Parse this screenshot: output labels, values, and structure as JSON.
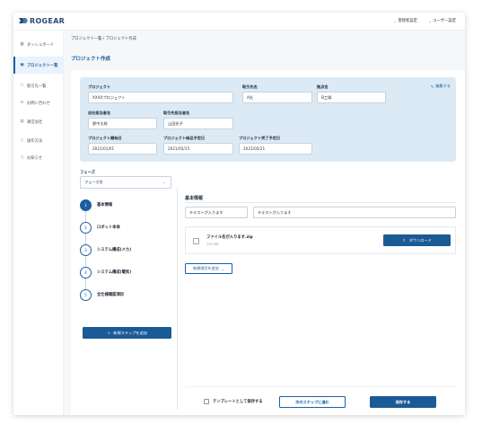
{
  "app": {
    "logo_text": "ROGEAR"
  },
  "topbar": {
    "admin_settings": "管理者設定",
    "user_settings": "ユーザー設定"
  },
  "sidebar": {
    "items": [
      {
        "label": "ダッシュボード",
        "icon": "dashboard-icon"
      },
      {
        "label": "プロジェクト一覧",
        "icon": "project-icon",
        "active": true
      },
      {
        "label": "取引先一覧",
        "icon": "client-icon"
      },
      {
        "label": "お問い合わせ",
        "icon": "mail-icon"
      },
      {
        "label": "運営会社",
        "icon": "building-icon"
      },
      {
        "label": "操作方法",
        "icon": "document-icon"
      },
      {
        "label": "お知らせ",
        "icon": "bell-icon"
      }
    ]
  },
  "main": {
    "breadcrumb": "プロジェクト一覧 / プロジェクト作成",
    "title": "プロジェクト作成"
  },
  "info": {
    "edit_link": "編集する",
    "project_label": "プロジェクト",
    "project_value": "XXXXプロジェクト",
    "client_label": "取引先名",
    "client_value": "A社",
    "site_label": "拠点名",
    "site_value": "B工場",
    "own_manager_label": "自社担当者名",
    "own_manager_value": "野中太郎",
    "client_manager_label": "取引先担当者名",
    "client_manager_value": "山田花子",
    "start_label": "プロジェクト開始日",
    "start_value": "2021/01/01",
    "delivery_label": "プロジェクト納品予定日",
    "delivery_value": "2021/05/15",
    "end_label": "プロジェクト完了予定日",
    "end_value": "2021/05/21"
  },
  "phase": {
    "label": "フェーズ",
    "selected": "フェーズ名"
  },
  "steps": [
    {
      "num": "1",
      "label": "基本情報",
      "active": true
    },
    {
      "num": "2",
      "label": "ロボット本体"
    },
    {
      "num": "3",
      "label": "システム構成(メカ)"
    },
    {
      "num": "4",
      "label": "システム構成(電気)"
    },
    {
      "num": "5",
      "label": "全仕様確認項目"
    }
  ],
  "add_step_label": "新規ステップを追加",
  "basic": {
    "title": "基本情報",
    "input1": "テキストが入ります",
    "input2": "テキストが入ります",
    "file_name": "ファイル名が入ります.zip",
    "file_size": "120 MB",
    "download_label": "ダウンロード",
    "add_item_label": "新規項目を追加"
  },
  "footer": {
    "template_label": "テンプレートとして保存する",
    "next_label": "次のステップに進む",
    "save_label": "保存する"
  },
  "colors": {
    "primary": "#1a5a95",
    "info_bg": "#dbeaf5",
    "active_bg": "#eaf3fb"
  }
}
